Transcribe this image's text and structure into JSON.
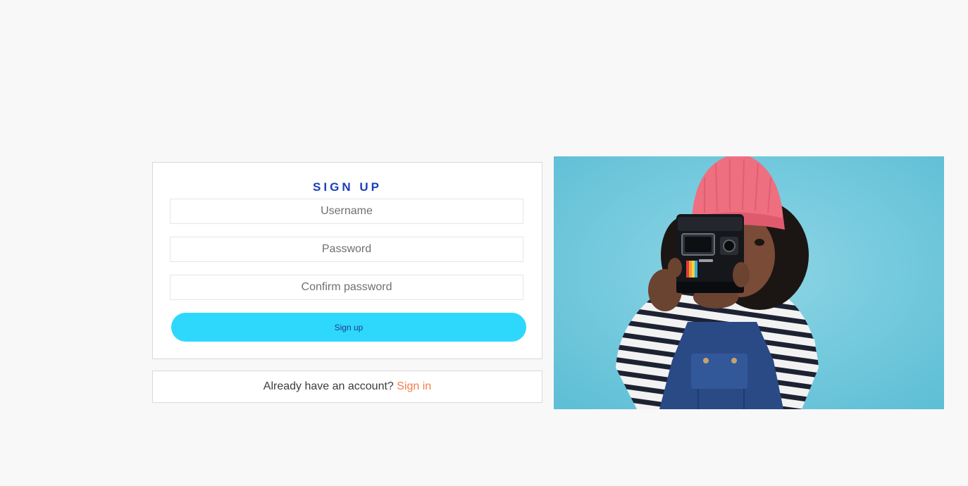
{
  "signup": {
    "title": "SIGN UP",
    "username_placeholder": "Username",
    "password_placeholder": "Password",
    "confirm_placeholder": "Confirm password",
    "button_label": "Sign up"
  },
  "signin": {
    "prompt": "Already have an account?",
    "link_label": "Sign in"
  },
  "colors": {
    "page_background": "#f8f8f8",
    "title": "#1c3fb8",
    "button_background": "#2ed8fd",
    "link": "#f47c4a",
    "photo_background": "#6cc8dc"
  },
  "photo": {
    "subject": "child in pink beanie holding an instant camera"
  }
}
